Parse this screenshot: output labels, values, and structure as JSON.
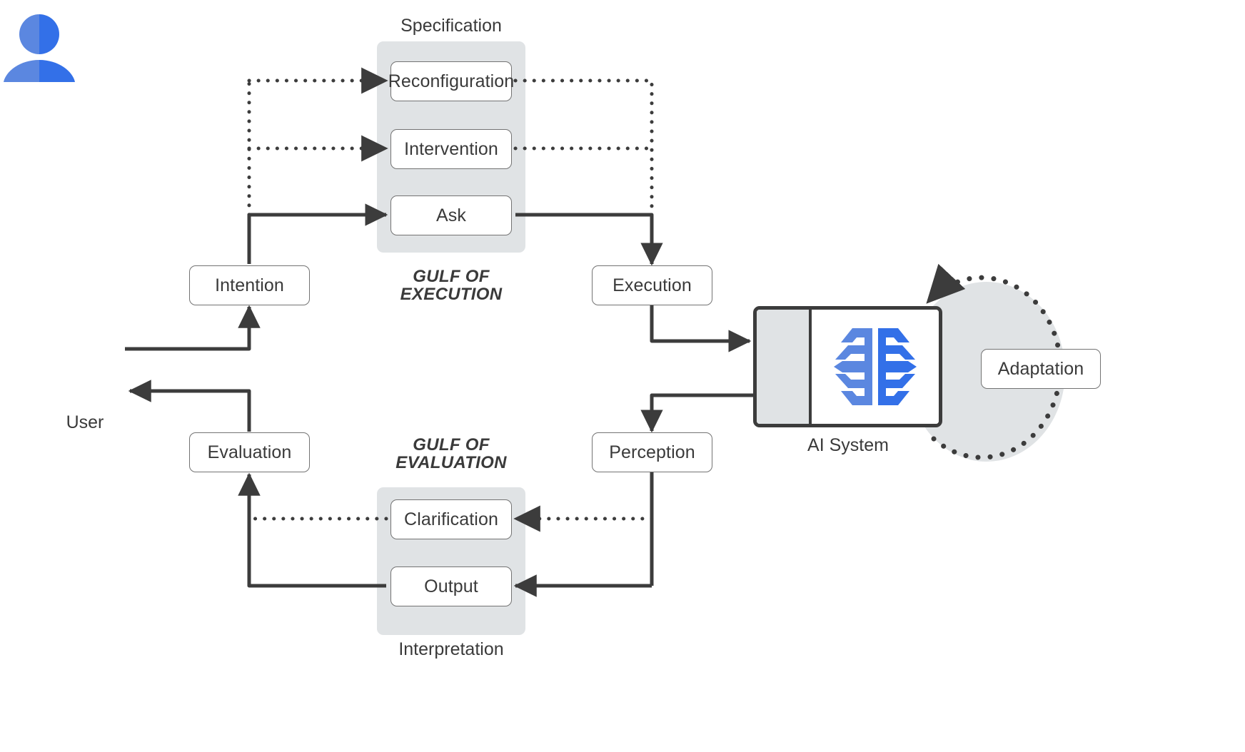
{
  "diagram": {
    "title": "Gulf of Execution and Gulf of Evaluation interaction loop",
    "colors": {
      "band_gray": "#e0e3e5",
      "stroke_dark": "#3c3c3c",
      "node_border": "#737373",
      "text": "#3a3a3a",
      "brand_blue_light": "#5b87e0",
      "brand_blue_dark": "#3370e8",
      "canvas": "#ffffff"
    },
    "groups": {
      "specification_label": "Specification",
      "interpretation_label": "Interpretation",
      "gulf_of_execution": "GULF OF\nEXECUTION",
      "gulf_of_evaluation": "GULF OF\nEVALUATION"
    },
    "actors": {
      "user_label": "User",
      "ai_system_label": "AI System",
      "user_icon": "user-avatar-icon",
      "ai_icon": "brain-icon"
    },
    "nodes": {
      "reconfiguration": "Reconfiguration",
      "intervention": "Intervention",
      "ask": "Ask",
      "intention": "Intention",
      "execution": "Execution",
      "adaptation": "Adaptation",
      "perception": "Perception",
      "clarification": "Clarification",
      "output": "Output",
      "evaluation": "Evaluation"
    },
    "edges": [
      {
        "from": "user",
        "to": "intention",
        "style": "solid"
      },
      {
        "from": "intention",
        "to": "ask",
        "style": "solid"
      },
      {
        "from": "intention",
        "to": "intervention",
        "style": "dotted"
      },
      {
        "from": "intention",
        "to": "reconfiguration",
        "style": "dotted"
      },
      {
        "from": "ask",
        "to": "execution",
        "style": "solid"
      },
      {
        "from": "intervention",
        "to": "execution",
        "style": "dotted"
      },
      {
        "from": "reconfiguration",
        "to": "execution",
        "style": "dotted"
      },
      {
        "from": "execution",
        "to": "ai-system",
        "style": "solid"
      },
      {
        "from": "ai-system",
        "to": "adaptation",
        "style": "dotted"
      },
      {
        "from": "ai-system",
        "to": "perception",
        "style": "solid"
      },
      {
        "from": "perception",
        "to": "output",
        "style": "solid"
      },
      {
        "from": "perception",
        "to": "clarification",
        "style": "dotted"
      },
      {
        "from": "output",
        "to": "evaluation",
        "style": "solid"
      },
      {
        "from": "clarification",
        "to": "evaluation",
        "style": "dotted"
      },
      {
        "from": "evaluation",
        "to": "user",
        "style": "solid"
      }
    ]
  }
}
